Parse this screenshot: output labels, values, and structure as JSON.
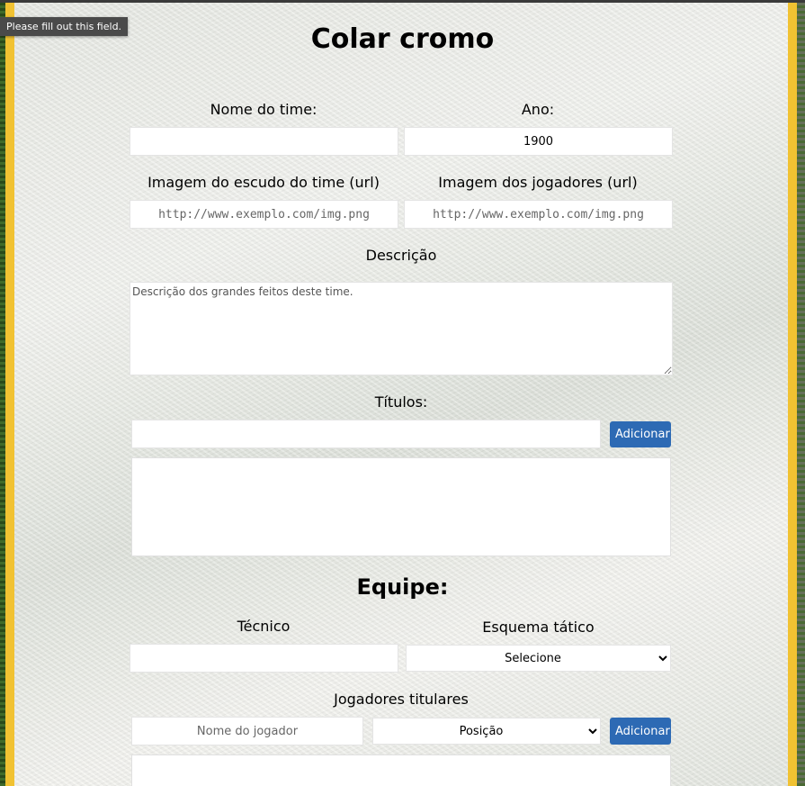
{
  "tooltip": "Please fill out this field.",
  "page_title": "Colar cromo",
  "team_name": {
    "label": "Nome do time:",
    "value": ""
  },
  "year": {
    "label": "Ano:",
    "value": "1900"
  },
  "crest_image": {
    "label": "Imagem do escudo do time (url)",
    "placeholder": "http://www.exemplo.com/img.png"
  },
  "players_image": {
    "label": "Imagem dos jogadores (url)",
    "placeholder": "http://www.exemplo.com/img.png"
  },
  "description": {
    "label": "Descrição",
    "placeholder": "Descrição dos grandes feitos deste time."
  },
  "titles": {
    "label": "Títulos:",
    "add_label": "Adicionar"
  },
  "team_section_title": "Equipe:",
  "coach": {
    "label": "Técnico",
    "value": ""
  },
  "formation": {
    "label": "Esquema tático",
    "selected": "Selecione"
  },
  "starters": {
    "label": "Jogadores titulares",
    "player_placeholder": "Nome do jogador",
    "position_selected": "Posição",
    "add_label": "Adicionar"
  },
  "colors": {
    "frame": "#f1c232",
    "button": "#2d6ab4"
  }
}
